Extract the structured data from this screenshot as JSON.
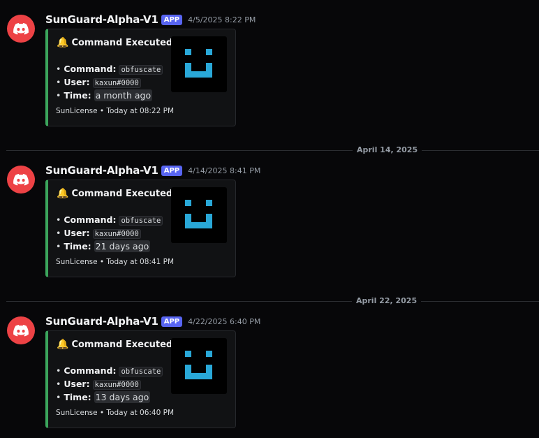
{
  "colors": {
    "avatar": "#ed4245",
    "app_badge": "#5865f2",
    "embed_accent": "#3ba55c",
    "thumbnail_face": "#29a8d8",
    "background": "#070709"
  },
  "messages": [
    {
      "username": "SunGuard-Alpha-V1",
      "badge": "APP",
      "timestamp": "4/5/2025 8:22 PM",
      "embed": {
        "icon": "bell-icon",
        "title": "Command Executed",
        "fields": [
          {
            "label": "Command:",
            "value": "obfuscate"
          },
          {
            "label": "User:",
            "value": "kaxun#0000"
          },
          {
            "label": "Time:",
            "value": "a month ago"
          }
        ],
        "footer": "SunLicense • Today at 08:22 PM"
      }
    },
    {
      "username": "SunGuard-Alpha-V1",
      "badge": "APP",
      "timestamp": "4/14/2025 8:41 PM",
      "embed": {
        "icon": "bell-icon",
        "title": "Command Executed",
        "fields": [
          {
            "label": "Command:",
            "value": "obfuscate"
          },
          {
            "label": "User:",
            "value": "kaxun#0000"
          },
          {
            "label": "Time:",
            "value": "21 days ago"
          }
        ],
        "footer": "SunLicense • Today at 08:41 PM"
      }
    },
    {
      "username": "SunGuard-Alpha-V1",
      "badge": "APP",
      "timestamp": "4/22/2025 6:40 PM",
      "embed": {
        "icon": "bell-icon",
        "title": "Command Executed",
        "fields": [
          {
            "label": "Command:",
            "value": "obfuscate"
          },
          {
            "label": "User:",
            "value": "kaxun#0000"
          },
          {
            "label": "Time:",
            "value": "13 days ago"
          }
        ],
        "footer": "SunLicense • Today at 06:40 PM"
      }
    }
  ],
  "dividers": [
    "April 14, 2025",
    "April 22, 2025"
  ]
}
